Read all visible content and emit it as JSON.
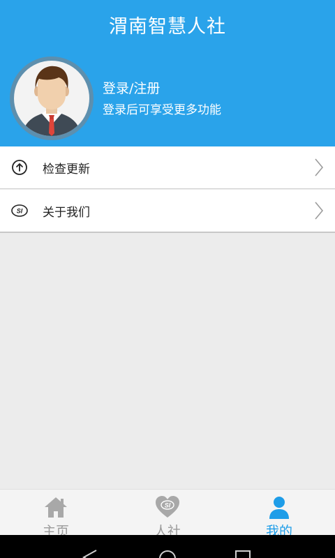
{
  "header": {
    "title": "渭南智慧人社",
    "login_link": "登录/注册",
    "login_hint": "登录后可享受更多功能"
  },
  "menu": {
    "items": [
      {
        "label": "检查更新",
        "icon": "arrow-up-circle-icon"
      },
      {
        "label": "关于我们",
        "icon": "si-logo-icon"
      }
    ]
  },
  "tabbar": {
    "tabs": [
      {
        "label": "主页",
        "icon": "home-icon",
        "active": false
      },
      {
        "label": "人社",
        "icon": "si-heart-icon",
        "active": false
      },
      {
        "label": "我的",
        "icon": "person-icon",
        "active": true
      }
    ]
  },
  "colors": {
    "primary": "#2aa3ea",
    "active_tab": "#1e9de8",
    "inactive_tab": "#9a9a9a"
  }
}
